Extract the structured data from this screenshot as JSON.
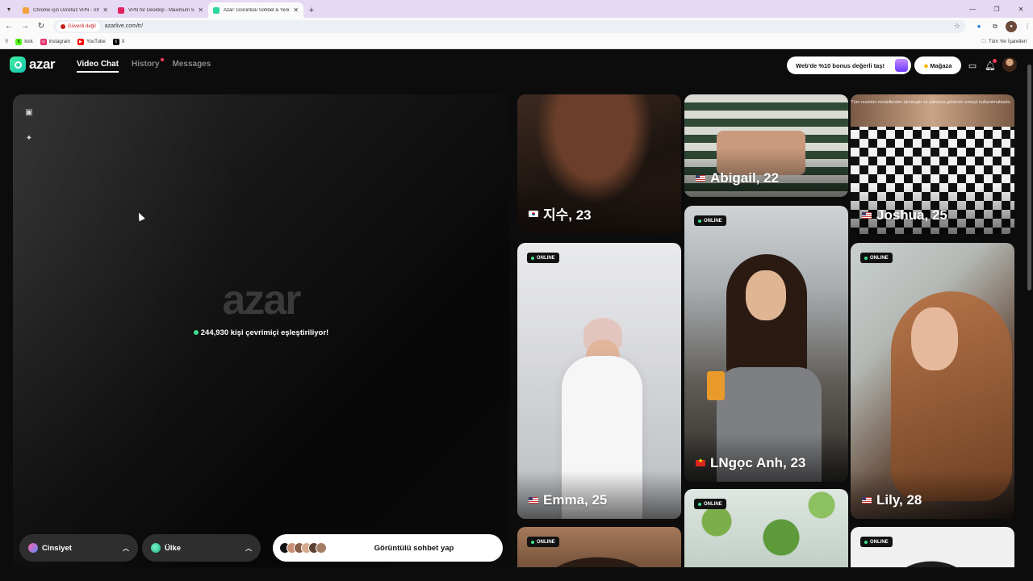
{
  "browser": {
    "tabs": [
      {
        "title": "Chrome için Ücretsiz VPN - VPN",
        "favicon_color": "#f2a23a"
      },
      {
        "title": "VPN for Desktop - Maximum Se",
        "favicon_color": "#e0245e"
      },
      {
        "title": "Azar: Görüntülü Sohbet & Yeni",
        "favicon_color": "#2bd6a0"
      }
    ],
    "security_label": "Güvenli değil",
    "url": "azarlive.com/tr/",
    "bookmarks": [
      {
        "label": "kick",
        "icon": "kick-icon",
        "color": "#53fc18"
      },
      {
        "label": "instagram",
        "icon": "instagram-icon",
        "color": "#e1306c"
      },
      {
        "label": "YouTube",
        "icon": "youtube-icon",
        "color": "#ff0000"
      },
      {
        "label": "X",
        "icon": "x-icon",
        "color": "#000000"
      }
    ],
    "all_bookmarks_label": "Tüm Yer İşaretleri"
  },
  "site": {
    "logo_text": "azar",
    "nav": [
      {
        "label": "Video Chat",
        "active": true
      },
      {
        "label": "History",
        "active": false,
        "notification_dot": true
      },
      {
        "label": "Messages",
        "active": false
      }
    ],
    "promo_label": "Web'de %10 bonus değerli taş!",
    "store_label": "Mağaza",
    "accent_color": "#3ee08f"
  },
  "video_panel": {
    "watermark": "azar",
    "online_text": "244,930 kişi çevrimiçi eşleştiriliyor!",
    "gender_filter_label": "Cinsiyet",
    "country_filter_label": "Ülke",
    "start_label": "Görüntülü sohbet yap"
  },
  "profiles": {
    "disclaimer": "Tüm resimler modellerden alınmıştır ve yalnızca gösterim amaçlı kullanılmaktadır.",
    "online_label": "ONLINE",
    "cards": [
      {
        "name": "지수, 23",
        "flag": "kr",
        "online": false
      },
      {
        "name": "Abigail, 22",
        "flag": "us",
        "online": false
      },
      {
        "name": "Joshua, 25",
        "flag": "us",
        "online": false
      },
      {
        "name": "Emma, 25",
        "flag": "us",
        "online": true
      },
      {
        "name": "LNgọc Anh, 23",
        "flag": "vn",
        "online": true
      },
      {
        "name": "Lily, 28",
        "flag": "us",
        "online": true
      },
      {
        "name": "",
        "flag": "",
        "online": true
      },
      {
        "name": "",
        "flag": "",
        "online": true
      },
      {
        "name": "",
        "flag": "",
        "online": true
      }
    ]
  }
}
